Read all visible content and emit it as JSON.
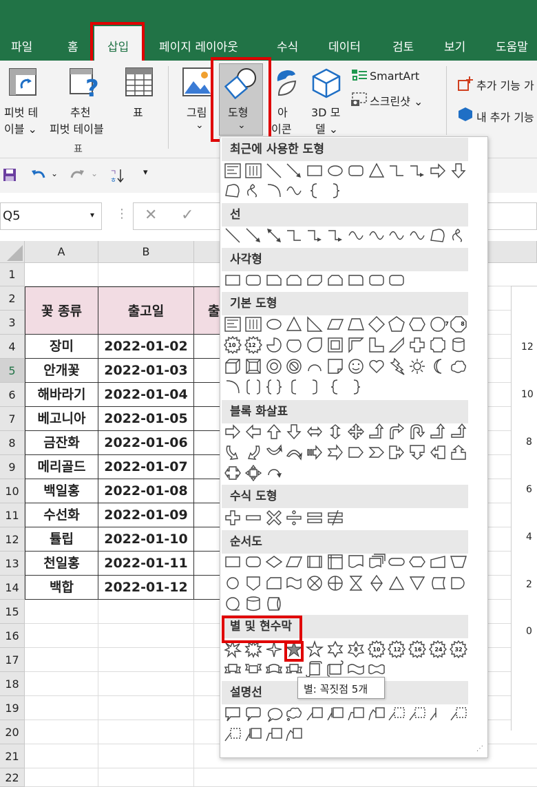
{
  "tabs": [
    "파일",
    "홈",
    "삽입",
    "페이지 레이아웃",
    "수식",
    "데이터",
    "검토",
    "보기",
    "도움말"
  ],
  "ribbon": {
    "pivot_table": [
      "피벗 테",
      "이블 ⌄"
    ],
    "recommended_pivot": [
      "추천",
      "피벗 테이블"
    ],
    "table": "표",
    "group_label": "표",
    "picture": [
      "그림",
      "⌄"
    ],
    "shapes": [
      "도형",
      "⌄"
    ],
    "icons": [
      "아",
      "이콘"
    ],
    "model3d": [
      "3D 모",
      "델 ⌄"
    ],
    "smartart": "SmartArt",
    "screenshot": "스크린샷 ⌄",
    "addins": "추가 기능 가",
    "my_addins": "내 추가 기능"
  },
  "namebox": "Q5",
  "columns": [
    "A",
    "B",
    "출"
  ],
  "rows": [
    "1",
    "2",
    "3",
    "4",
    "5",
    "6",
    "7",
    "8",
    "9",
    "10",
    "11",
    "12",
    "13",
    "14",
    "15",
    "16",
    "17",
    "18",
    "19",
    "20",
    "21",
    "22"
  ],
  "table": {
    "header": [
      "꽃 종류",
      "출고일"
    ],
    "rows": [
      [
        "장미",
        "2022-01-02"
      ],
      [
        "안개꽃",
        "2022-01-03"
      ],
      [
        "해바라기",
        "2022-01-04"
      ],
      [
        "베고니아",
        "2022-01-05"
      ],
      [
        "금잔화",
        "2022-01-06"
      ],
      [
        "메리골드",
        "2022-01-07"
      ],
      [
        "백일홍",
        "2022-01-08"
      ],
      [
        "수선화",
        "2022-01-09"
      ],
      [
        "튤립",
        "2022-01-10"
      ],
      [
        "천일홍",
        "2022-01-11"
      ],
      [
        "백합",
        "2022-01-12"
      ]
    ]
  },
  "chart_axis": [
    "12",
    "10",
    "8",
    "6",
    "4",
    "2",
    "0"
  ],
  "dropdown": {
    "sections": [
      "최근에 사용한 도형",
      "선",
      "사각형",
      "기본 도형",
      "블록 화살표",
      "수식 도형",
      "순서도",
      "별 및 현수막",
      "설명선"
    ],
    "tooltip": "별: 꼭짓점 5개",
    "badges": [
      "8",
      "10",
      "12",
      "16",
      "24",
      "32",
      "7",
      "8",
      "10",
      "12"
    ]
  },
  "colors": {
    "excel_green": "#217346",
    "highlight_red": "#e00000",
    "header_fill": "#f2dce3"
  }
}
